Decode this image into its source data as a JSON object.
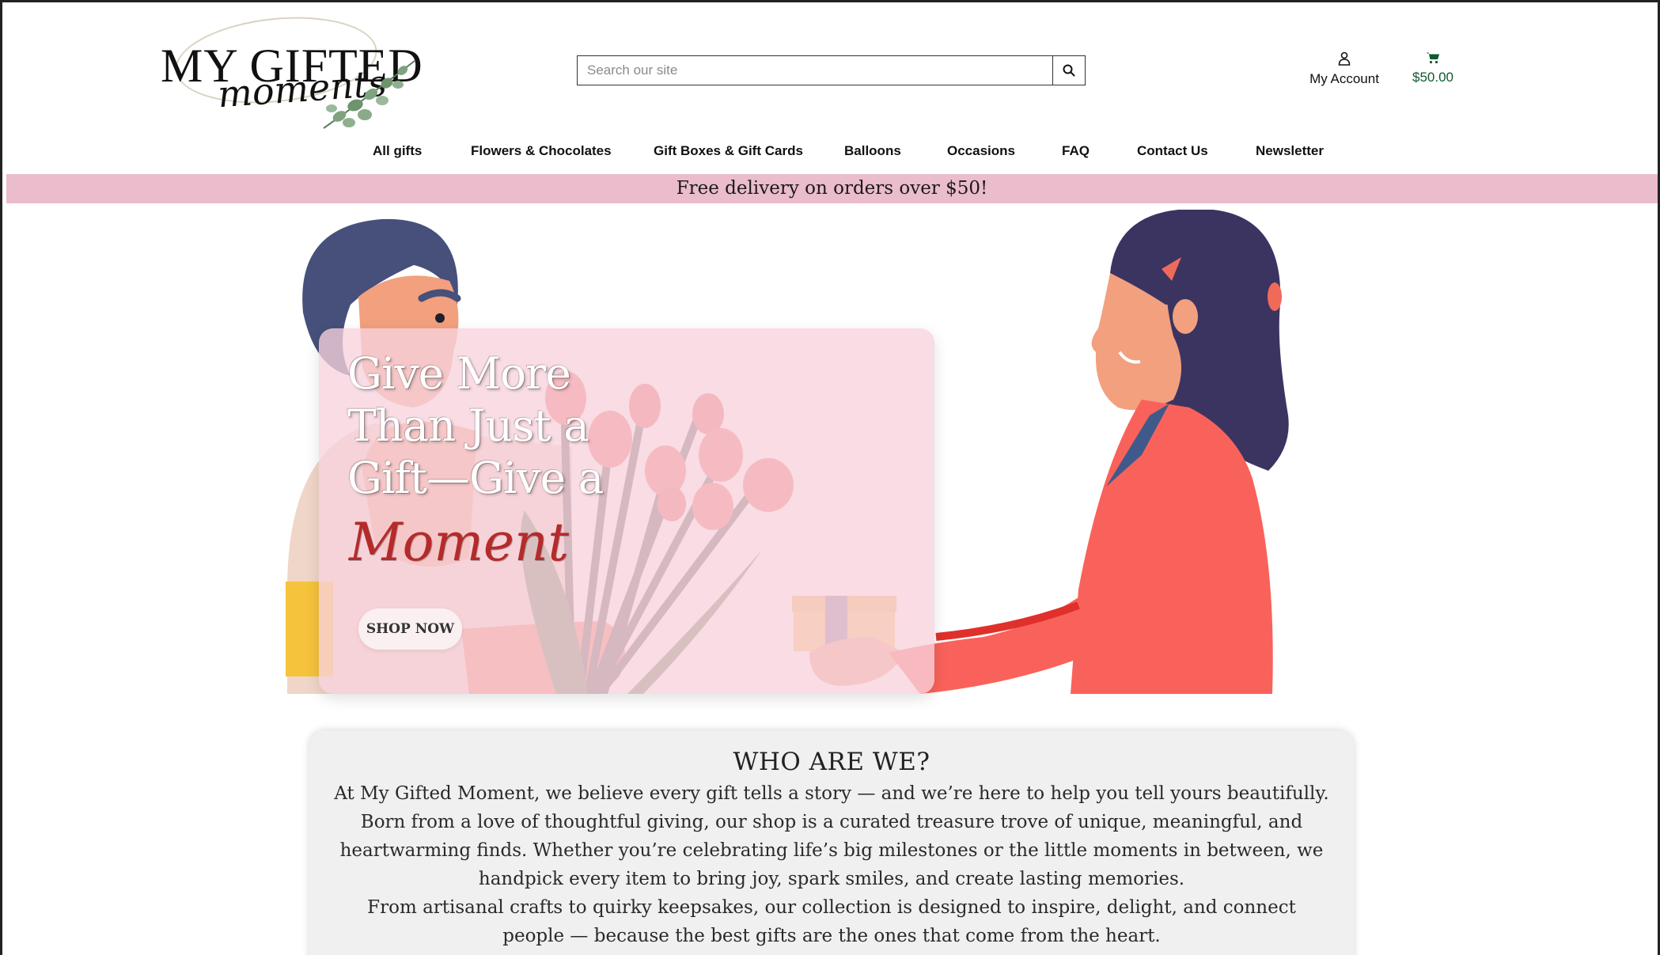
{
  "header": {
    "logo": {
      "main": "MY GIFTED",
      "script": "moments"
    },
    "search": {
      "placeholder": "Search our site"
    },
    "account": {
      "label": "My Account"
    },
    "cart": {
      "total": "$50.00"
    }
  },
  "nav": {
    "items": [
      {
        "label": "All gifts"
      },
      {
        "label": "Flowers & Chocolates"
      },
      {
        "label": "Gift Boxes & Gift Cards"
      },
      {
        "label": "Balloons"
      },
      {
        "label": "Occasions"
      },
      {
        "label": "FAQ"
      },
      {
        "label": "Contact Us"
      },
      {
        "label": "Newsletter"
      }
    ]
  },
  "banner": {
    "text": "Free delivery on orders over $50!"
  },
  "hero": {
    "lines": [
      "Give More",
      "Than Just a",
      "Gift—Give a"
    ],
    "script": "Moment",
    "cta": "SHOP NOW"
  },
  "about": {
    "title": "WHO ARE WE?",
    "p1": "At My Gifted Moment, we believe every gift tells a story — and we’re here to help you tell yours beautifully.",
    "p2": "Born from a love of thoughtful giving, our shop is a curated treasure trove of unique, meaningful, and heartwarming finds. Whether you’re celebrating life’s big milestones or the little moments in between, we handpick every item to bring joy, spark smiles, and create lasting memories.",
    "p3": "From artisanal crafts to quirky keepsakes, our collection is designed to inspire, delight, and connect people — because the best gifts are the ones that come from the heart."
  },
  "colors": {
    "banner": "#ebbccb",
    "cart_total": "#0f5a30",
    "accent_red": "#b52a2a",
    "card_pink": "#f7d2dc",
    "about_bg": "#f0f0f0"
  },
  "icons": [
    "search-icon",
    "user-icon",
    "cart-icon"
  ]
}
